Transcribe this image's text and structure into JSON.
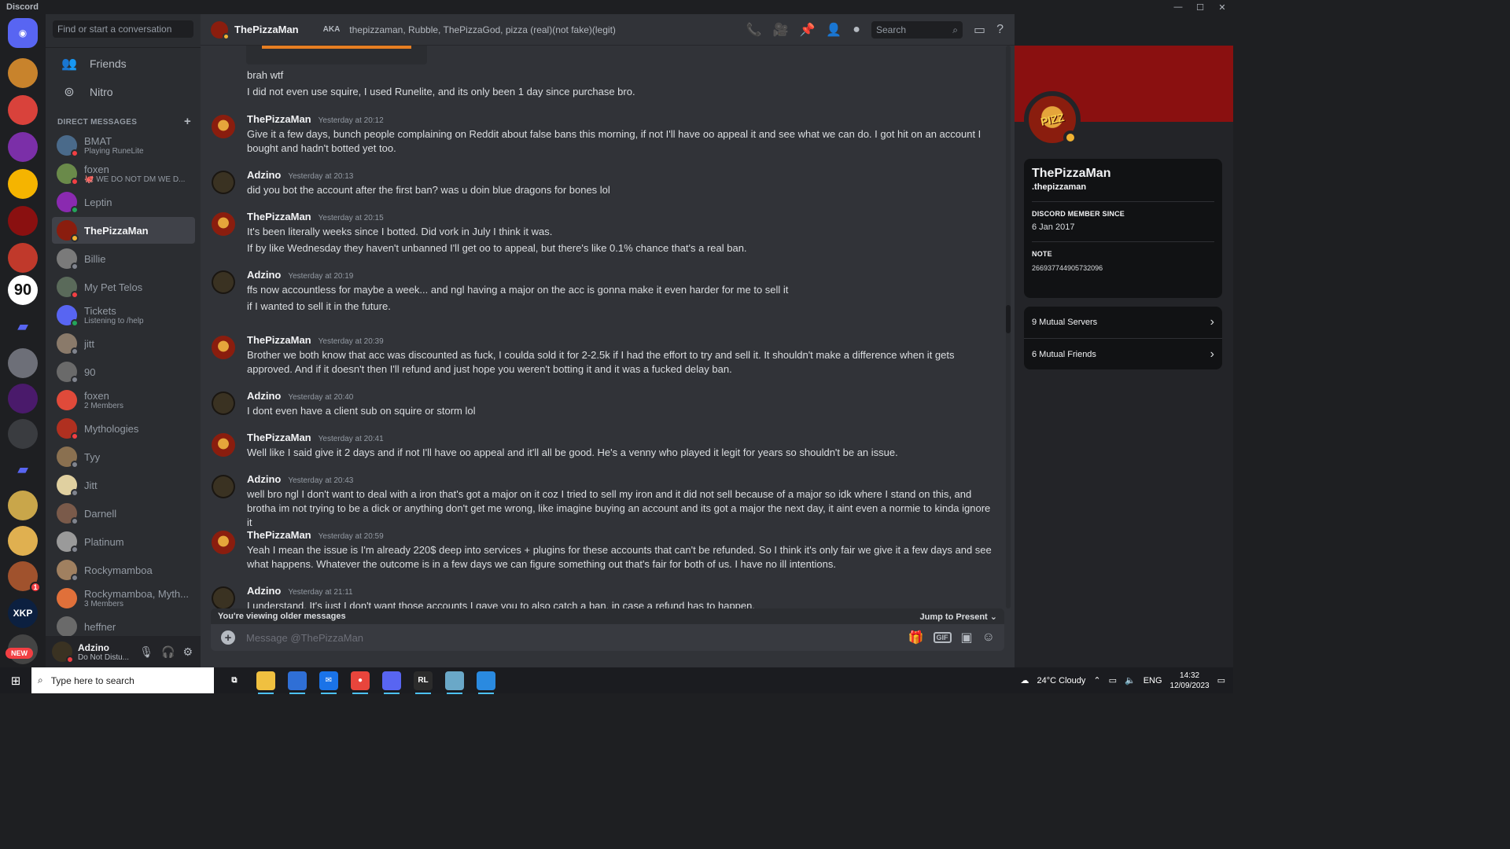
{
  "app": {
    "title": "Discord",
    "window_controls": [
      "—",
      "☐",
      "✕"
    ]
  },
  "guilds": [
    {
      "label": "",
      "color": "#5865f2",
      "type": "home"
    },
    {
      "label": "",
      "color": "#c8832c"
    },
    {
      "label": "",
      "color": "#d9423b"
    },
    {
      "label": "",
      "color": "#7b2fa8"
    },
    {
      "label": "",
      "color": "#f5b400"
    },
    {
      "label": "",
      "color": "#8a1010"
    },
    {
      "label": "",
      "color": "#c0392b"
    },
    {
      "label": "90",
      "color": "#ffffff"
    },
    {
      "label": "",
      "color": "#5865f2",
      "type": "folder"
    },
    {
      "label": "",
      "color": "#6d6f78"
    },
    {
      "label": "",
      "color": "#4a1a6b"
    },
    {
      "label": "",
      "color": "#3a3c40"
    },
    {
      "label": "",
      "color": "#5865f2",
      "type": "folder"
    },
    {
      "label": "",
      "color": "#c9a64a"
    },
    {
      "label": "",
      "color": "#e0b050"
    },
    {
      "label": "",
      "color": "#a0522d",
      "badge": "1"
    },
    {
      "label": "XKP",
      "color": "#0c2040"
    },
    {
      "label": "",
      "color": "#444"
    }
  ],
  "guild_new_label": "NEW",
  "sidebar": {
    "search_placeholder": "Find or start a conversation",
    "nav": [
      {
        "label": "Friends",
        "icon": "friends-icon"
      },
      {
        "label": "Nitro",
        "icon": "nitro-icon"
      }
    ],
    "dm_header": "DIRECT MESSAGES",
    "dms": [
      {
        "name": "BMAT",
        "sub": "Playing RuneLite",
        "status": "dnd",
        "color": "#4a6a8a"
      },
      {
        "name": "foxen",
        "sub": "🐙 WE DO NOT DM WE D...",
        "status": "dnd",
        "color": "#6a8a4a"
      },
      {
        "name": "Leptin",
        "sub": "",
        "status": "on",
        "color": "#8a2ab0"
      },
      {
        "name": "ThePizzaMan",
        "sub": "",
        "status": "idle",
        "color": "#8a1d0e",
        "active": true
      },
      {
        "name": "Billie",
        "sub": "",
        "status": "off",
        "color": "#7a7a7a"
      },
      {
        "name": "My Pet Telos",
        "sub": "",
        "status": "dnd",
        "color": "#5a6a5a"
      },
      {
        "name": "Tickets",
        "sub": "Listening to /help",
        "status": "on",
        "color": "#5865f2"
      },
      {
        "name": "jitt",
        "sub": "",
        "status": "off",
        "color": "#8a7a6a"
      },
      {
        "name": "90",
        "sub": "",
        "status": "off",
        "color": "#6a6a6a"
      },
      {
        "name": "foxen",
        "sub": "2 Members",
        "status": "",
        "color": "#e04a3a"
      },
      {
        "name": "Mythologies",
        "sub": "",
        "status": "dnd",
        "color": "#b03020"
      },
      {
        "name": "Tyy",
        "sub": "",
        "status": "off",
        "color": "#8a7050"
      },
      {
        "name": "Jitt",
        "sub": "",
        "status": "off",
        "color": "#e0d0a0"
      },
      {
        "name": "Darnell",
        "sub": "",
        "status": "off",
        "color": "#7a5a4a"
      },
      {
        "name": "Platinum",
        "sub": "",
        "status": "off",
        "color": "#9a9a9a"
      },
      {
        "name": "Rockymamboa",
        "sub": "",
        "status": "off",
        "color": "#a08060"
      },
      {
        "name": "Rockymamboa, Myth...",
        "sub": "3 Members",
        "status": "",
        "color": "#e0703a"
      },
      {
        "name": "heffner",
        "sub": "",
        "status": "",
        "color": "#6a6a6a"
      }
    ]
  },
  "user": {
    "name": "Adzino",
    "status": "Do Not Distu..."
  },
  "header": {
    "name": "ThePizzaMan",
    "aka_label": "AKA",
    "aliases": "thepizzaman, Rubble, ThePizzaGod, pizza (real)(not fake)(legit)",
    "search_placeholder": "Search"
  },
  "messages": {
    "continuation": [
      "brah wtf",
      "I did not even use squire, I used Runelite, and its only been 1 day since purchase bro."
    ],
    "groups": [
      {
        "author": "ThePizzaMan",
        "avatar": "pizza",
        "time": "Yesterday at 20:12",
        "lines": [
          "Give it a few days, bunch people complaining on Reddit about false bans this morning, if not I'll have oo appeal it and see what we can do. I got hit on an account I bought and hadn't botted yet too."
        ]
      },
      {
        "author": "Adzino",
        "avatar": "adz",
        "time": "Yesterday at 20:13",
        "lines": [
          "did you bot the account after the first ban? was u doin blue dragons for bones lol"
        ]
      },
      {
        "author": "ThePizzaMan",
        "avatar": "pizza",
        "time": "Yesterday at 20:15",
        "lines": [
          "It's been literally weeks since I botted. Did vork in July I think it was.",
          "If by like Wednesday they haven't unbanned I'll get oo to appeal, but there's like 0.1% chance that's a real ban."
        ]
      },
      {
        "author": "Adzino",
        "avatar": "adz",
        "time": "Yesterday at 20:19",
        "lines": [
          "ffs now accountless for maybe a week... and ngl having a major on the acc is gonna make it even harder for me to sell it",
          "if I wanted to sell it in the future."
        ]
      },
      {
        "author": "ThePizzaMan",
        "avatar": "pizza",
        "time": "Yesterday at 20:39",
        "lines": [
          "Brother we both know that acc was discounted as fuck, I coulda sold it for 2-2.5k if I had the effort to try and sell it. It shouldn't make a difference when it gets approved. And if it doesn't then I'll refund and just hope you weren't botting it and it was a fucked delay ban."
        ]
      },
      {
        "author": "Adzino",
        "avatar": "adz",
        "time": "Yesterday at 20:40",
        "lines": [
          "I dont even have a client sub on squire or storm lol"
        ]
      },
      {
        "author": "ThePizzaMan",
        "avatar": "pizza",
        "time": "Yesterday at 20:41",
        "lines": [
          "Well like I said give it 2 days and if not I'll have oo appeal and it'll all be good. He's a venny who played it legit for years so shouldn't be an issue."
        ]
      },
      {
        "author": "Adzino",
        "avatar": "adz",
        "time": "Yesterday at 20:43",
        "lines": [
          "well bro ngl I don't want to deal with a iron that's got a major on it coz I tried to sell my iron and it did not sell because of a major so idk where I stand on this, and brotha im not trying to be a dick or anything don't get me wrong, like imagine buying an account and its got a major the next day, it aint even a normie to kinda ignore it"
        ]
      },
      {
        "author": "ThePizzaMan",
        "avatar": "pizza",
        "time": "Yesterday at 20:59",
        "lines": [
          "Yeah I mean the issue is I'm already 220$ deep into services + plugins for these accounts that can't be refunded. So I think it's only fair we give it a few days and see what happens. Whatever the outcome is in a few days we can figure something out that's fair for both of us. I have no ill intentions."
        ]
      },
      {
        "author": "Adzino",
        "avatar": "adz",
        "time": "Yesterday at 21:11",
        "lines": [
          "I understand, It's just I don't want those accounts I gave you to also catch a ban, in case a refund has to happen."
        ]
      }
    ]
  },
  "older_bar": {
    "text": "You're viewing older messages",
    "jump": "Jump to Present"
  },
  "composer": {
    "placeholder": "Message @ThePizzaMan",
    "gif": "GIF"
  },
  "profile": {
    "name": "ThePizzaMan",
    "tag": ".thepizzaman",
    "avatar_text": "PIZZ",
    "member_since_label": "DISCORD MEMBER SINCE",
    "member_since": "6 Jan 2017",
    "note_label": "NOTE",
    "note": "266937744905732096",
    "mutual_servers": "9 Mutual Servers",
    "mutual_friends": "6 Mutual Friends"
  },
  "taskbar": {
    "search_placeholder": "Type here to search",
    "weather": "24°C  Cloudy",
    "lang": "ENG",
    "time": "14:32",
    "date": "12/09/2023",
    "apps": [
      {
        "icon": "task-view-icon",
        "color": "transparent",
        "label": "⧉"
      },
      {
        "icon": "explorer-icon",
        "color": "#f0c040",
        "label": ""
      },
      {
        "icon": "store-icon",
        "color": "#2f6fd6",
        "label": ""
      },
      {
        "icon": "mail-icon",
        "color": "#1a73e8",
        "label": "✉"
      },
      {
        "icon": "chrome-icon",
        "color": "#e8453c",
        "label": "●"
      },
      {
        "icon": "discord-app-icon",
        "color": "#5865f2",
        "label": ""
      },
      {
        "icon": "runelite-icon",
        "color": "#2b2b2b",
        "label": "RL"
      },
      {
        "icon": "notepad-icon",
        "color": "#6aa8c8",
        "label": ""
      },
      {
        "icon": "paint-icon",
        "color": "#2a8ae0",
        "label": ""
      }
    ],
    "weather_badge": "1"
  }
}
